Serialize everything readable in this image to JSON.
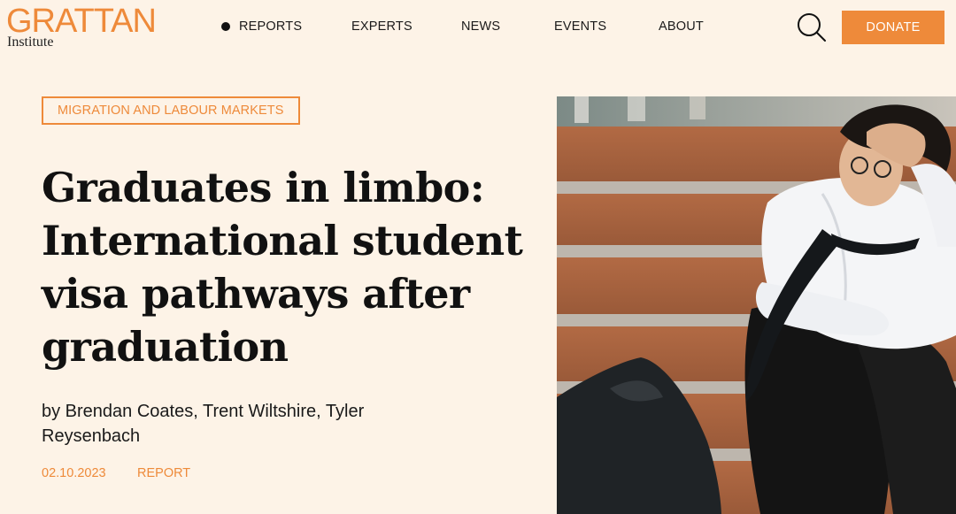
{
  "header": {
    "logo_main": "GRATTAN",
    "logo_sub": "Institute",
    "nav": [
      "REPORTS",
      "EXPERTS",
      "NEWS",
      "EVENTS",
      "ABOUT"
    ],
    "active_nav": "REPORTS",
    "search_icon": "search-icon",
    "donate_label": "DONATE"
  },
  "article": {
    "category": "MIGRATION AND LABOUR MARKETS",
    "title": "Graduates in limbo: International student visa pathways after graduation",
    "byline": "by Brendan Coates, Trent Wiltshire, Tyler Reysenbach",
    "date": "02.10.2023",
    "type": "REPORT"
  },
  "colors": {
    "accent": "#ee8a3a",
    "background": "#fdf3e7",
    "text": "#111111"
  }
}
